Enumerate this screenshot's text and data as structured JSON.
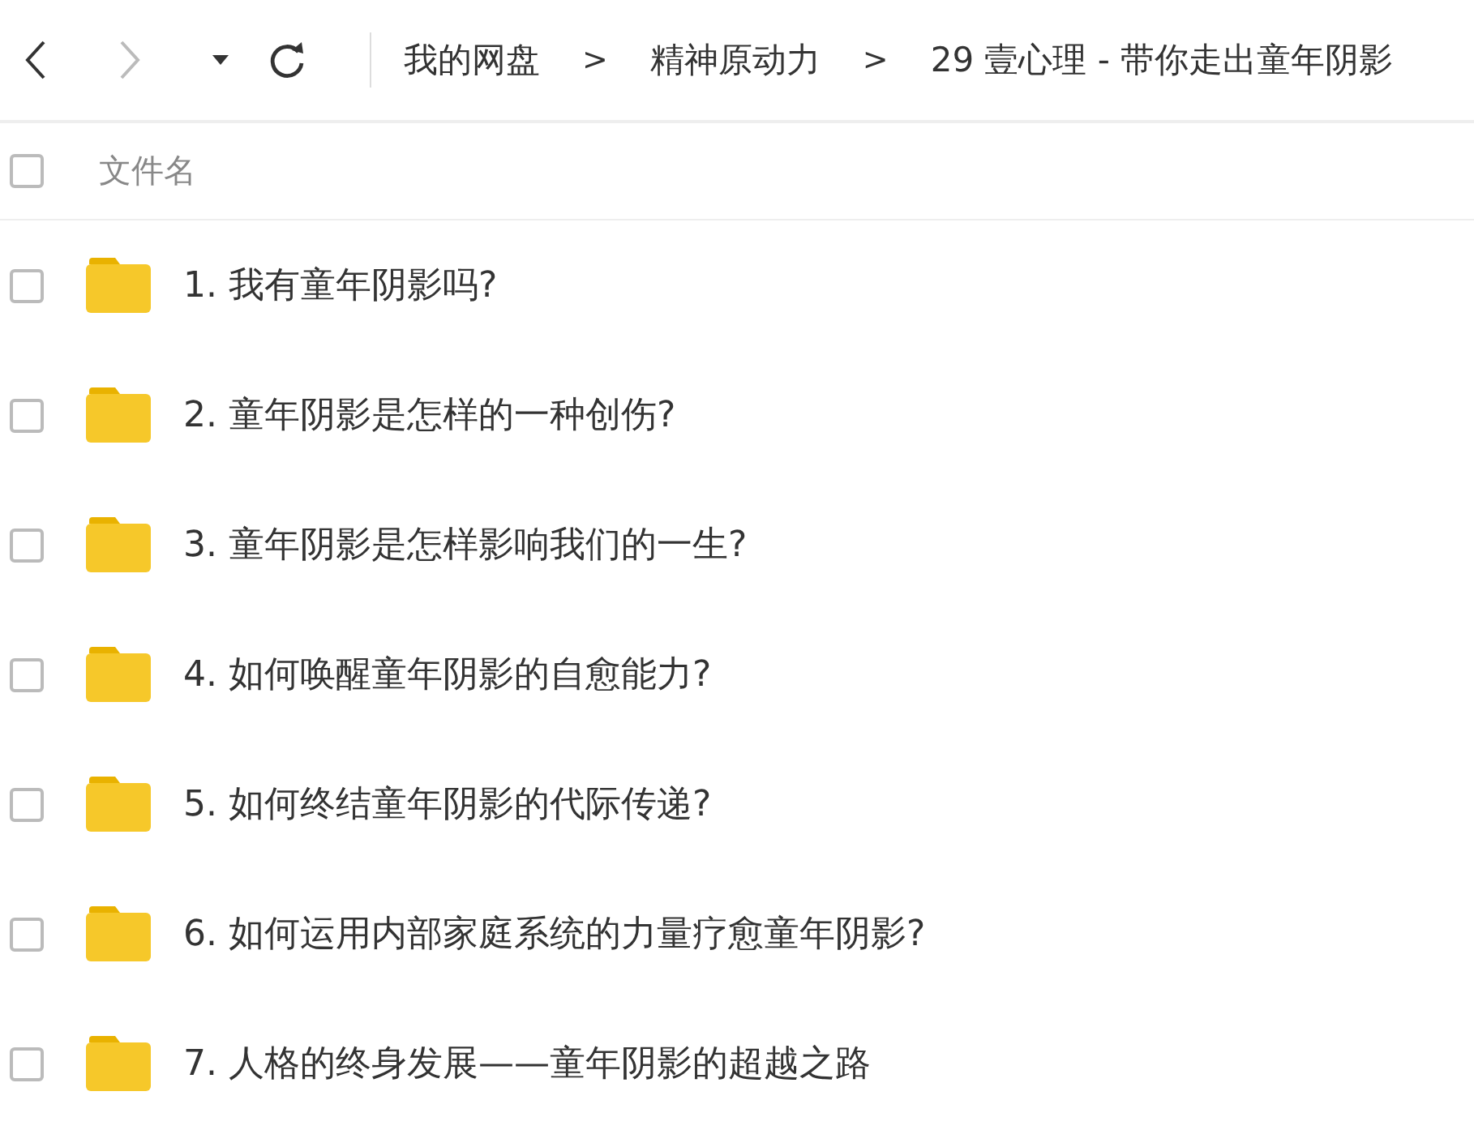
{
  "toolbar": {
    "nav": [
      {
        "kind": "back",
        "disabled": false
      },
      {
        "kind": "forward",
        "disabled": true
      },
      {
        "kind": "dropdown",
        "disabled": false
      },
      {
        "kind": "refresh",
        "disabled": false
      }
    ],
    "breadcrumbs": [
      {
        "label": "我的网盘"
      },
      {
        "label": ">"
      },
      {
        "label": "精神原动力"
      },
      {
        "label": ">"
      },
      {
        "label": "29 壹心理 - 带你走出童年阴影"
      }
    ]
  },
  "header": {
    "checked": false,
    "label": "文件名"
  },
  "files": [
    {
      "name": "1. 我有童年阴影吗?",
      "checked": false
    },
    {
      "name": "2. 童年阴影是怎样的一种创伤?",
      "checked": false
    },
    {
      "name": "3. 童年阴影是怎样影响我们的一生?",
      "checked": false
    },
    {
      "name": "4. 如何唤醒童年阴影的自愈能力?",
      "checked": false
    },
    {
      "name": "5. 如何终结童年阴影的代际传递?",
      "checked": false
    },
    {
      "name": "6. 如何运用内部家庭系统的力量疗愈童年阴影?",
      "checked": false
    },
    {
      "name": "7. 人格的终身发展——童年阴影的超越之路",
      "checked": false
    }
  ]
}
